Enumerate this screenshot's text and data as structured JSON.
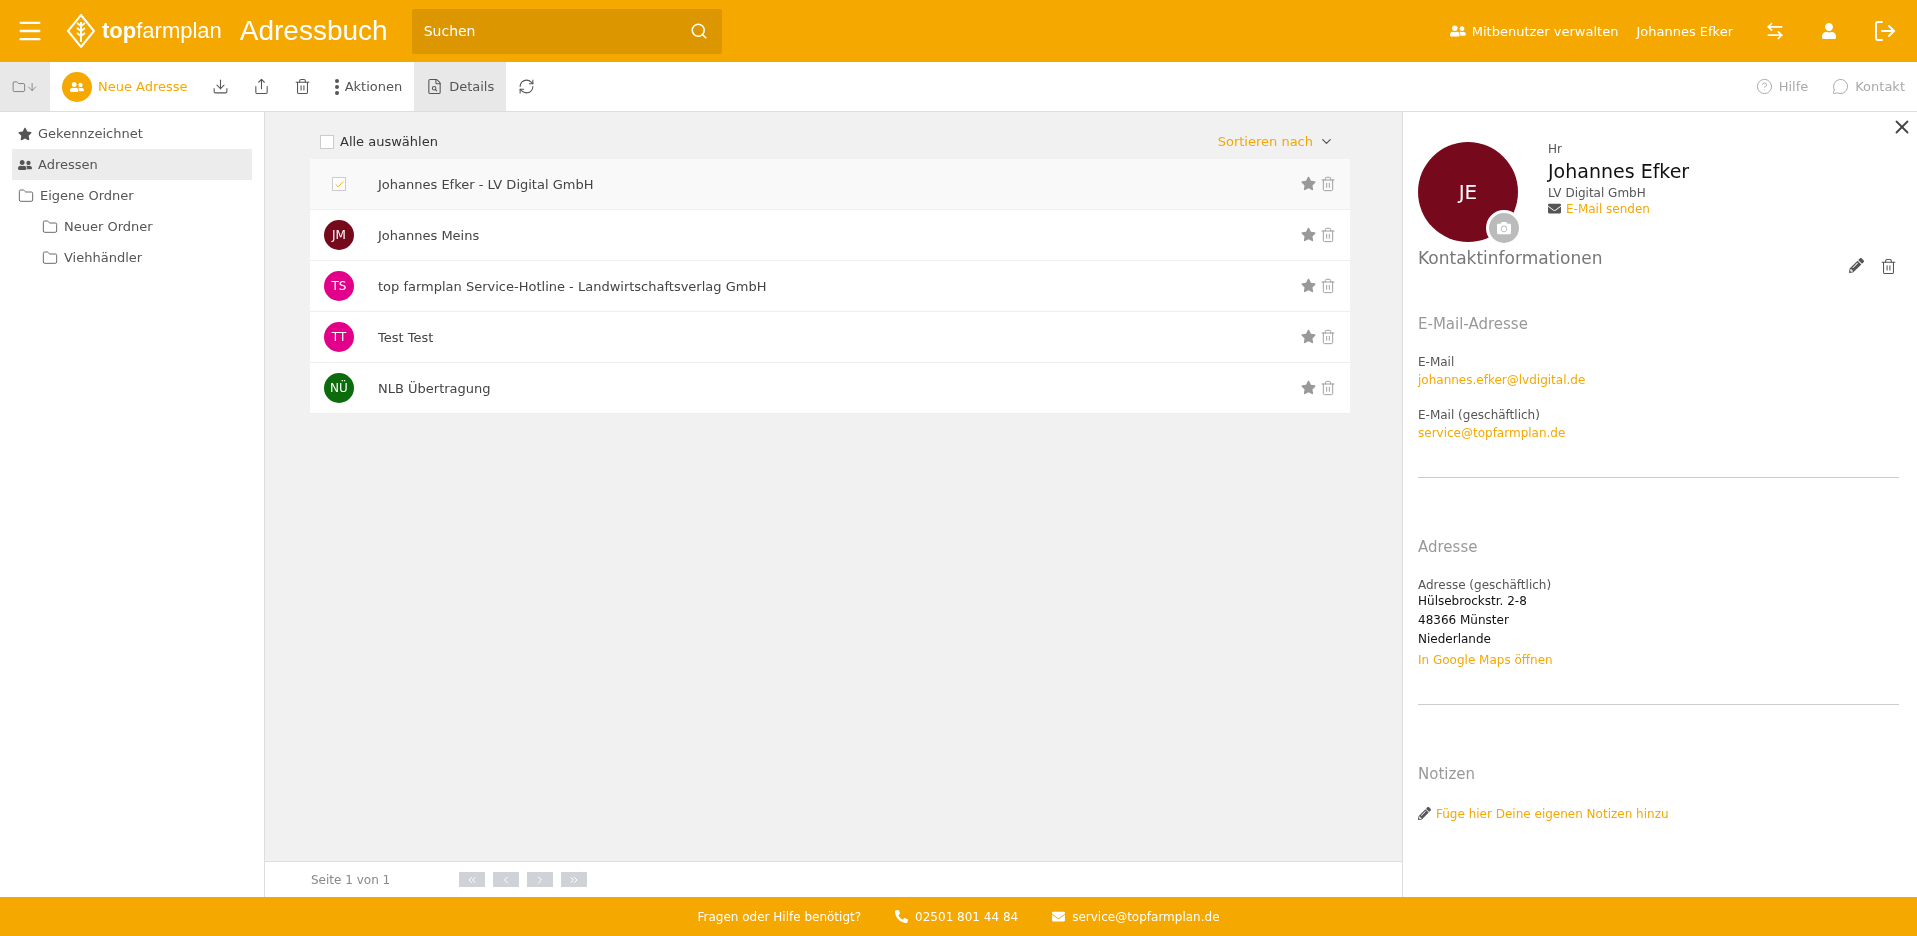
{
  "header": {
    "logo": "**top**farmplan",
    "title": "Adressbuch",
    "search": {
      "placeholder": "Suchen"
    },
    "share_users": "Mitbenutzer verwalten",
    "user": "Johannes Efker"
  },
  "toolbar": {
    "new_address": "Neue Adresse",
    "actions": "Aktionen",
    "details": {
      "label": "Details",
      "selected": true
    },
    "help": "Hilfe",
    "contact": "Kontakt"
  },
  "sidebar": {
    "items": [
      {
        "kind": "star",
        "label": "Gekennzeichnet",
        "selected": false
      },
      {
        "kind": "people",
        "label": "Adressen",
        "selected": true
      },
      {
        "kind": "folder",
        "label": "Eigene Ordner",
        "selected": false,
        "children": [
          {
            "kind": "folder",
            "label": "Neuer Ordner",
            "selected": false
          },
          {
            "kind": "folder",
            "label": "Viehhändler",
            "selected": false
          }
        ]
      }
    ]
  },
  "list": {
    "select_all": {
      "label": "Alle auswählen",
      "checked": false
    },
    "sort": "Sortieren nach",
    "rows": [
      {
        "name": "Johannes Efker - LV Digital GmbH",
        "selected": true
      },
      {
        "name": "Johannes Meins",
        "selected": false,
        "initials": "JM",
        "color": "#76091c"
      },
      {
        "name": "top farmplan Service-Hotline - Landwirtschaftsverlag GmbH",
        "selected": false,
        "initials": "TS",
        "color": "#e2008a"
      },
      {
        "name": "Test Test",
        "selected": false,
        "initials": "TT",
        "color": "#e2008a"
      },
      {
        "name": "NLB Übertragung",
        "selected": false,
        "initials": "NÜ",
        "color": "#0c6c0c"
      }
    ],
    "pagination": "Seite 1 von 1"
  },
  "detail": {
    "initials": "JE",
    "color": "#76091c",
    "salutation": "Hr",
    "name": "Johannes Efker",
    "company": "LV Digital GmbH",
    "send_mail": "E-Mail senden",
    "section_title": "Kontaktinformationen",
    "sections": [
      {
        "title": "E-Mail-Adresse",
        "fields": [
          {
            "label": "E-Mail",
            "lines": [
              "johannes.efker@lvdigital.de"
            ],
            "kind": "link"
          },
          {
            "label": "E-Mail (geschäftlich)",
            "lines": [
              "service@topfarmplan.de"
            ],
            "kind": "link"
          }
        ]
      },
      {
        "title": "Adresse",
        "fields": [
          {
            "label": "Adresse (geschäftlich)",
            "lines": [
              "Hülsebrockstr. 2-8",
              "48366 Münster",
              "Niederlande"
            ],
            "kind": "text",
            "link": "In Google Maps öffnen"
          }
        ]
      },
      {
        "title": "Notizen",
        "note": "Füge hier Deine eigenen Notizen hinzu"
      }
    ]
  },
  "footer": {
    "question": "Fragen oder Hilfe benötigt?",
    "phone": "02501 801 44 84",
    "email": "service@topfarmplan.de"
  }
}
